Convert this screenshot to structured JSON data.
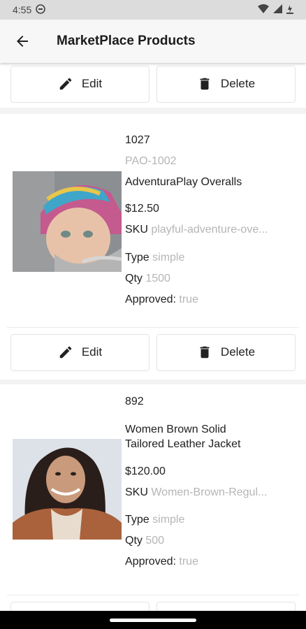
{
  "status_bar": {
    "time": "4:55"
  },
  "app_bar": {
    "title": "MarketPlace Products"
  },
  "buttons": {
    "edit_label": "Edit",
    "delete_label": "Delete"
  },
  "products": [
    {
      "id": "1027",
      "code": "PAO-1002",
      "name_line1": "AdventuraPlay Overalls",
      "name_line2": "",
      "price": "$12.50",
      "sku_label": "SKU",
      "sku": "playful-adventure-ove...",
      "type_label": "Type",
      "type": "simple",
      "qty_label": "Qty",
      "qty": "1500",
      "approved_label": "Approved:",
      "approved": "true"
    },
    {
      "id": "892",
      "code": "",
      "name_line1": "Women Brown Solid",
      "name_line2": "Tailored Leather Jacket",
      "price": "$120.00",
      "sku_label": "SKU",
      "sku": "Women-Brown-Regul...",
      "type_label": "Type",
      "type": "simple",
      "qty_label": "Qty",
      "qty": "500",
      "approved_label": "Approved:",
      "approved": "true"
    }
  ],
  "colors": {
    "muted_text": "#b5b5b5",
    "app_bar_bg": "#f7f7f7",
    "status_bar_bg": "#dcdcdc"
  }
}
